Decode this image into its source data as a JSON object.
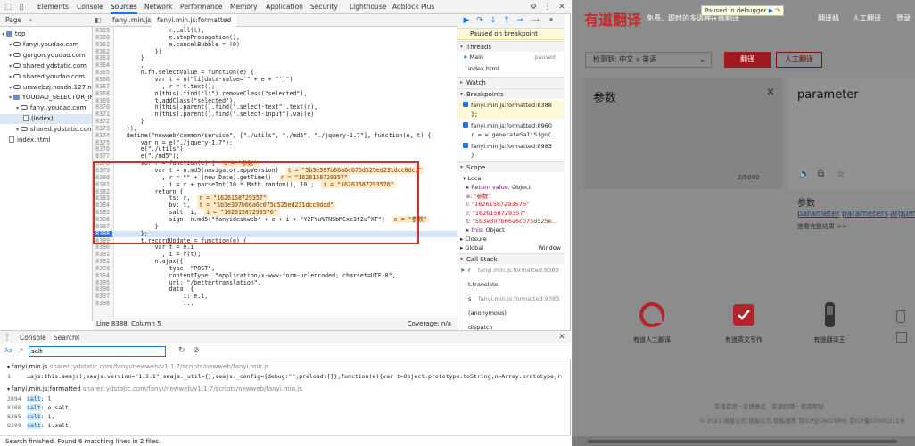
{
  "devtools": {
    "top_tabs": [
      "Elements",
      "Console",
      "Sources",
      "Network",
      "Performance",
      "Memory",
      "Application",
      "Security",
      "Lighthouse",
      "Adblock Plus"
    ],
    "active_top_tab": "Sources",
    "source_tabs": [
      "Page",
      "fanyi.min.js",
      "fanyi.min.js:formatted"
    ],
    "navigator": [
      {
        "label": "top",
        "type": "folder",
        "indent": 0
      },
      {
        "label": "fanyi.youdao.com",
        "type": "cloud",
        "indent": 1
      },
      {
        "label": "gorgon.youdao.com",
        "type": "cloud",
        "indent": 1
      },
      {
        "label": "shared.ydstatic.com",
        "type": "cloud",
        "indent": 1
      },
      {
        "label": "shared.youdao.com",
        "type": "cloud",
        "indent": 1
      },
      {
        "label": "urswebzj.nosdn.127.net",
        "type": "cloud",
        "indent": 1
      },
      {
        "label": "YOUDAO_SELECTOR_IFRA…",
        "type": "folder",
        "indent": 1
      },
      {
        "label": "fanyi.youdao.com",
        "type": "cloud",
        "indent": 2
      },
      {
        "label": "(index)",
        "type": "file",
        "indent": 3,
        "selected": true
      },
      {
        "label": "shared.ydstatic.com",
        "type": "cloud",
        "indent": 2
      },
      {
        "label": "index.html",
        "type": "file",
        "indent": 1
      }
    ],
    "code_lines": [
      {
        "n": "8359",
        "t": "                r.call(t),"
      },
      {
        "n": "8360",
        "t": "                e.stopPropagation(),"
      },
      {
        "n": "8361",
        "t": "                e.cancelBubble = !0)"
      },
      {
        "n": "8362",
        "t": "            })"
      },
      {
        "n": "8363",
        "t": "        }"
      },
      {
        "n": "8364",
        "t": "        ,"
      },
      {
        "n": "8365",
        "t": "        n.fn.selectValue = function(e) {"
      },
      {
        "n": "8366",
        "t": "            var t = n(\"li[data-value='\" + e + \"']\")"
      },
      {
        "n": "8367",
        "t": "              , r = t.text();"
      },
      {
        "n": "8368",
        "t": "            n(this).find(\"li\").removeClass(\"selected\"),"
      },
      {
        "n": "8369",
        "t": "            t.addClass(\"selected\"),"
      },
      {
        "n": "8370",
        "t": "            n(this).parent().find(\".select-text\").text(r),"
      },
      {
        "n": "8371",
        "t": "            n(this).parent().find(\".select-input\").val(e)"
      },
      {
        "n": "8372",
        "t": "        }"
      },
      {
        "n": "8373",
        "t": "    }),"
      },
      {
        "n": "8374",
        "t": "    define(\"newweb/common/service\", [\"./utils\", \"./md5\", \"./jquery-1.7\"], function(e, t) {"
      },
      {
        "n": "8375",
        "t": "        var n = e(\"./jquery-1.7\");"
      },
      {
        "n": "8376",
        "t": "        e(\"./utils\");"
      },
      {
        "n": "8377",
        "t": "        e(\"./md5\");"
      },
      {
        "n": "8378",
        "t": "        var r = function(e) {",
        "h": "e = \"参数\""
      },
      {
        "n": "8379",
        "t": "            var t = n.md5(navigator.appVersion)",
        "h": "t = \"5b3e307b66a6c075d525ed231dcc8dcd\""
      },
      {
        "n": "8380",
        "t": "              , r = \"\" + (new Date).getTime()",
        "h": "r = \"1626158729357\""
      },
      {
        "n": "8381",
        "t": "              , i = r + parseInt(10 * Math.random(), 10);",
        "h": "i = \"16261587293576\""
      },
      {
        "n": "8382",
        "t": "            return {"
      },
      {
        "n": "8383",
        "t": "                ts: r,",
        "h": "r = \"1626158729357\""
      },
      {
        "n": "8384",
        "t": "                bv: t,",
        "h": "t = \"5b3e307b66a6c075d525ed231dcc8dcd\""
      },
      {
        "n": "8385",
        "t": "                salt: i,",
        "h": "i = \"16261587293576\""
      },
      {
        "n": "8386",
        "t": "                sign: n.md5(\"fanyideskweb\" + e + i + \"Y2FYu%TNSbMCxc3t2u^XT\")",
        "h": "e = \"参数\""
      },
      {
        "n": "8387",
        "t": "            }"
      },
      {
        "n": "8388",
        "t": "        };",
        "bp": true
      },
      {
        "n": "8389",
        "t": "        t.recordUpdate = function(e) {"
      },
      {
        "n": "8390",
        "t": "            var t = e.i"
      },
      {
        "n": "8391",
        "t": "              , i = r(t);"
      },
      {
        "n": "8392",
        "t": "            n.ajax({"
      },
      {
        "n": "8393",
        "t": "                type: \"POST\","
      },
      {
        "n": "8394",
        "t": "                contentType: \"application/x-www-form-urlencoded; charset=UTF-8\","
      },
      {
        "n": "8395",
        "t": "                url: \"/bettertranslation\","
      },
      {
        "n": "8396",
        "t": "                data: {"
      },
      {
        "n": "8397",
        "t": "                    i: e.i,"
      },
      {
        "n": "8398",
        "t": "                    ..."
      }
    ],
    "editor_status": {
      "position": "Line 8388, Column 5",
      "coverage": "Coverage: n/a"
    },
    "debugger": {
      "paused_label": "Paused on breakpoint",
      "threads_label": "Threads",
      "thread_main": "Main",
      "thread_state": "paused",
      "thread_index": "index.html",
      "watch_label": "Watch",
      "breakpoints_label": "Breakpoints",
      "breakpoints": [
        {
          "file": "fanyi.min.js:formatted:8388",
          "code": "};"
        },
        {
          "file": "fanyi.min.js:formatted:8960",
          "code": "r = w.generateSaltSign(…"
        },
        {
          "file": "fanyi.min.js:formatted:8983",
          "code": "}"
        }
      ],
      "scope_label": "Scope",
      "local_label": "Local",
      "scope_vars": [
        {
          "k": "▸ Return value:",
          "v": "Object"
        },
        {
          "k": "e:",
          "v": "\"参数\""
        },
        {
          "k": "i:",
          "v": "\"16261587293576\""
        },
        {
          "k": "r:",
          "v": "\"1626158729357\""
        },
        {
          "k": "t:",
          "v": "\"5b3e307b66a6c075d525e…"
        },
        {
          "k": "▸ this:",
          "v": "Object"
        }
      ],
      "closure_label": "Closure",
      "global_label": "Global",
      "global_value": "Window",
      "callstack_label": "Call Stack",
      "callstack": [
        {
          "fn": "r",
          "loc": "fanyi.min.js:formatted:8388"
        },
        {
          "fn": "t.translate",
          "loc": "fanyi.min.js:formatted:8953"
        },
        {
          "fn": "s",
          "loc": "fanyi.min.js:formatted:9383"
        },
        {
          "fn": "(anonymous)",
          "loc": "fanyi.min.js:formatted:9469"
        },
        {
          "fn": "dispatch",
          "loc": ""
        }
      ]
    },
    "drawer_tabs": [
      "Console",
      "Search"
    ],
    "search": {
      "aa": "Aa",
      "regex": ".*",
      "value": "salt",
      "results": [
        {
          "file": "fanyi.min.js",
          "path": "shared.ydstatic.com/fanyi/newweb/v1.1.7/scripts/newweb/fanyi.min.js"
        },
        {
          "line": "1",
          "text": "…ajs:this.seajs),seajs.version=\"1.3.1\",seajs._util={},seajs._config={debug:\"\",preload:[]},function(e){var t=Object.prototype.toString,n=Array.prototype,r=n.indexOf,i=n.forEach,s=n.map,o=n.filter,u=n.reduce,a=n.lastIndexOf,f={}.hasOwnProperty;e.isString=function(e){return\"[object String]\"===t…"
        },
        {
          "file": "fanyi.min.js:formatted",
          "path": "shared.ydstatic.com/fanyi/newweb/v1.1.7/scripts/newweb/fanyi.min.js"
        },
        {
          "line": "2894",
          "pre": "",
          "m": "salt",
          "post": ": l"
        },
        {
          "line": "8308",
          "pre": "",
          "m": "salt",
          "post": ": o.salt,"
        },
        {
          "line": "8385",
          "pre": "",
          "m": "salt",
          "post": ": i,"
        },
        {
          "line": "8399",
          "pre": "",
          "m": "salt",
          "post": ": i.salt,"
        }
      ],
      "status": "Search finished.  Found 6 matching lines in 2 files."
    }
  },
  "site": {
    "logo": "有道翻译",
    "slogan": "免费、即时的多语种在线翻译",
    "paused_in_debugger": "Paused in debugger",
    "nav": [
      "翻译机",
      "人工翻译",
      "登录"
    ],
    "lang_select": "检测到: 中文 » 英语",
    "translate_btn": "翻译",
    "human_btn": "人工翻译",
    "input_text": "参数",
    "counter": "2/5000",
    "output_text": "parameter",
    "dict_word": "参数",
    "dict_links": [
      "parameter",
      "parameters",
      "argume…"
    ],
    "more_link": "查看完整结果 >>",
    "features": [
      "有道人工翻译",
      "有道英文写作",
      "有道翻译王"
    ],
    "footer_links": "有道首页  ·  反馈意见  ·  有道招聘  ·  使用帮助",
    "copyright": "© 2021 网易公司  网易公司 隐私政策  京ICP证080268号  京ICP备10005211号"
  },
  "colors": {
    "accent": "#1a73e8",
    "brand_red": "#c7262b",
    "box_red": "#d32f2f"
  }
}
